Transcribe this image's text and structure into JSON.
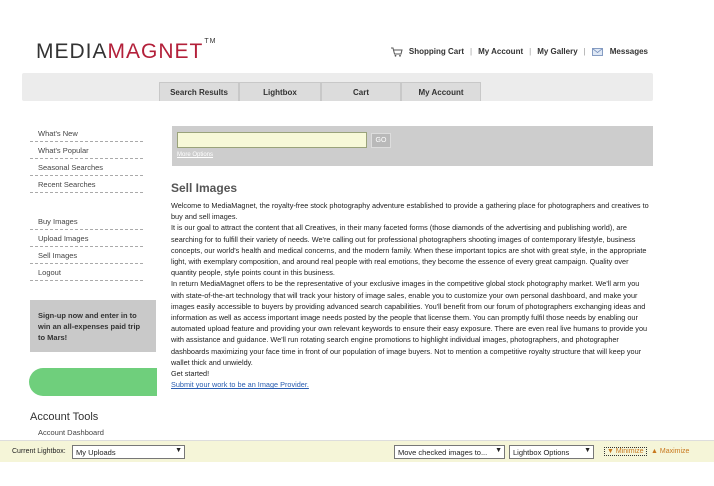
{
  "logo": {
    "part1": "MEDIA",
    "part2": "MAGNET",
    "tm": "TM"
  },
  "topnav": {
    "cart": "Shopping Cart",
    "account": "My Account",
    "gallery": "My Gallery",
    "messages": "Messages",
    "sep": "|"
  },
  "tabs": [
    "Search Results",
    "Lightbox",
    "Cart",
    "My Account"
  ],
  "sidebar": {
    "nav1": [
      "What's New",
      "What's Popular",
      "Seasonal Searches",
      "Recent Searches"
    ],
    "nav2": [
      "Buy Images",
      "Upload Images",
      "Sell Images",
      "Logout"
    ],
    "promo": "Sign-up now and enter in to win an all-expenses paid trip to Mars!",
    "account_title": "Account Tools",
    "account_item": "Account Dashboard"
  },
  "search": {
    "value": "",
    "go": "GO",
    "more": "More Options"
  },
  "main": {
    "title": "Sell Images",
    "p1": "Welcome to MediaMagnet, the royalty-free stock photography adventure established to provide a gathering place for photographers and creatives to buy and sell images.",
    "p2": "It is our goal to attract the content that all Creatives, in their many faceted forms (those diamonds of the advertising and publishing world), are searching for to fulfill their variety of needs. We're calling out for professional photographers shooting images of contemporary lifestyle, business concepts, our world's health and medical concerns, and the modern family. When these important topics are shot with great style, in the appropriate light, with exemplary composition, and around real people with real emotions, they become the essence of every great campaign. Quality over quantity people, style points count in this business.",
    "p3": "In return MediaMagnet offers to be the representative of your exclusive images in the competitive global stock photography market. We'll arm you with state-of-the-art technology that will track your history of image sales, enable you to customize your own personal dashboard, and make your images easily accessible to buyers by providing advanced search capabilities. You'll benefit from our forum of photographers exchanging ideas and information as well as access important image needs posted by the people that license them. You can promptly fulfil those needs by enabling our automated upload feature and providing your own relevant keywords to ensure their easy exposure. There are even real live humans to provide you with assistance and guidance. We'll run rotating search engine promotions to highlight individual images, photographers, and photographer dashboards maximizing your face time in front of our population of image buyers. Not to mention a competitive royalty structure that will keep your wallet thick and unwieldy.",
    "p4": "Get started!",
    "link": "Submit your work to be an Image Provider."
  },
  "toolbar": {
    "label": "Current Lightbox:",
    "lightbox_selected": "My Uploads",
    "move_selected": "Move checked images to...",
    "options_selected": "Lightbox Options",
    "minimize": "Minimize",
    "maximize": "Maximize",
    "arrow": "▼"
  },
  "colors": {
    "brand_red": "#b3203a",
    "green": "#6fcf7c",
    "toolbar_bg": "#f5f5d8"
  }
}
